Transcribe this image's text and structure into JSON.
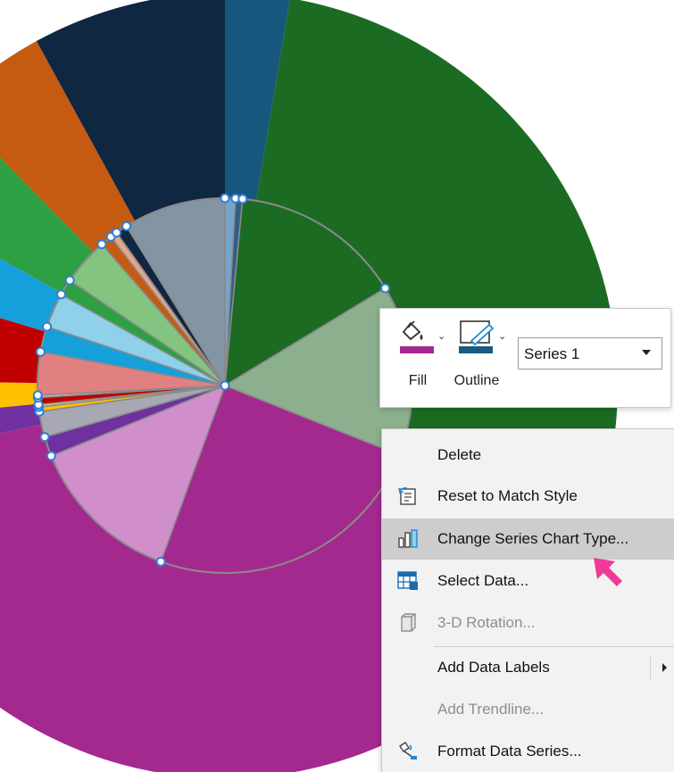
{
  "toolbar": {
    "fill_label": "Fill",
    "outline_label": "Outline",
    "series_value": "Series 1",
    "fill_color": "#a3298f",
    "outline_color": "#1b5a80"
  },
  "context_menu": {
    "items": [
      {
        "label": "Delete",
        "icon": "none",
        "enabled": true
      },
      {
        "label": "Reset to Match Style",
        "icon": "reset-style-icon",
        "enabled": true
      },
      {
        "label": "Change Series Chart Type...",
        "icon": "chart-type-icon",
        "enabled": true,
        "highlighted": true
      },
      {
        "label": "Select Data...",
        "icon": "select-data-icon",
        "enabled": true
      },
      {
        "label": "3-D Rotation...",
        "icon": "cube-icon",
        "enabled": false
      },
      {
        "label": "Add Data Labels",
        "icon": "none",
        "enabled": true,
        "submenu": true
      },
      {
        "label": "Add Trendline...",
        "icon": "none",
        "enabled": false
      },
      {
        "label": "Format Data Series...",
        "icon": "format-series-icon",
        "enabled": true
      }
    ]
  },
  "chart_data": {
    "type": "pie",
    "outer_ring": {
      "values": [
        3,
        33,
        45,
        2,
        2,
        5,
        4,
        5,
        5,
        9
      ],
      "colors": [
        "#17577d",
        "#1c6b23",
        "#a3298f",
        "#7030a0",
        "#ffc000",
        "#c00000",
        "#16a0db",
        "#2da043",
        "#c55a11",
        "#0f2741"
      ]
    },
    "inner_pie": {
      "selected": true,
      "values": [
        0.9,
        0.6,
        14.8,
        14.7,
        24.5,
        13.3,
        1.7,
        2.2,
        0.4,
        0.2,
        0.6,
        0.2,
        3.7,
        2.2,
        3.0,
        1.4,
        4.1,
        1.0,
        0.6,
        1.0,
        8.8
      ],
      "colors": [
        "#77a5c9",
        "#305f86",
        "#1c6b23",
        "#8cb08e",
        "#a3298f",
        "#d08fca",
        "#7030a0",
        "#a8a8b4",
        "#ffc000",
        "#fbe6a2",
        "#c00000",
        "#f4c6c6",
        "#e08080",
        "#16a0db",
        "#8fd0eb",
        "#2da043",
        "#82c480",
        "#c55a11",
        "#e8a487",
        "#0f2741",
        "#8394a3"
      ]
    }
  }
}
